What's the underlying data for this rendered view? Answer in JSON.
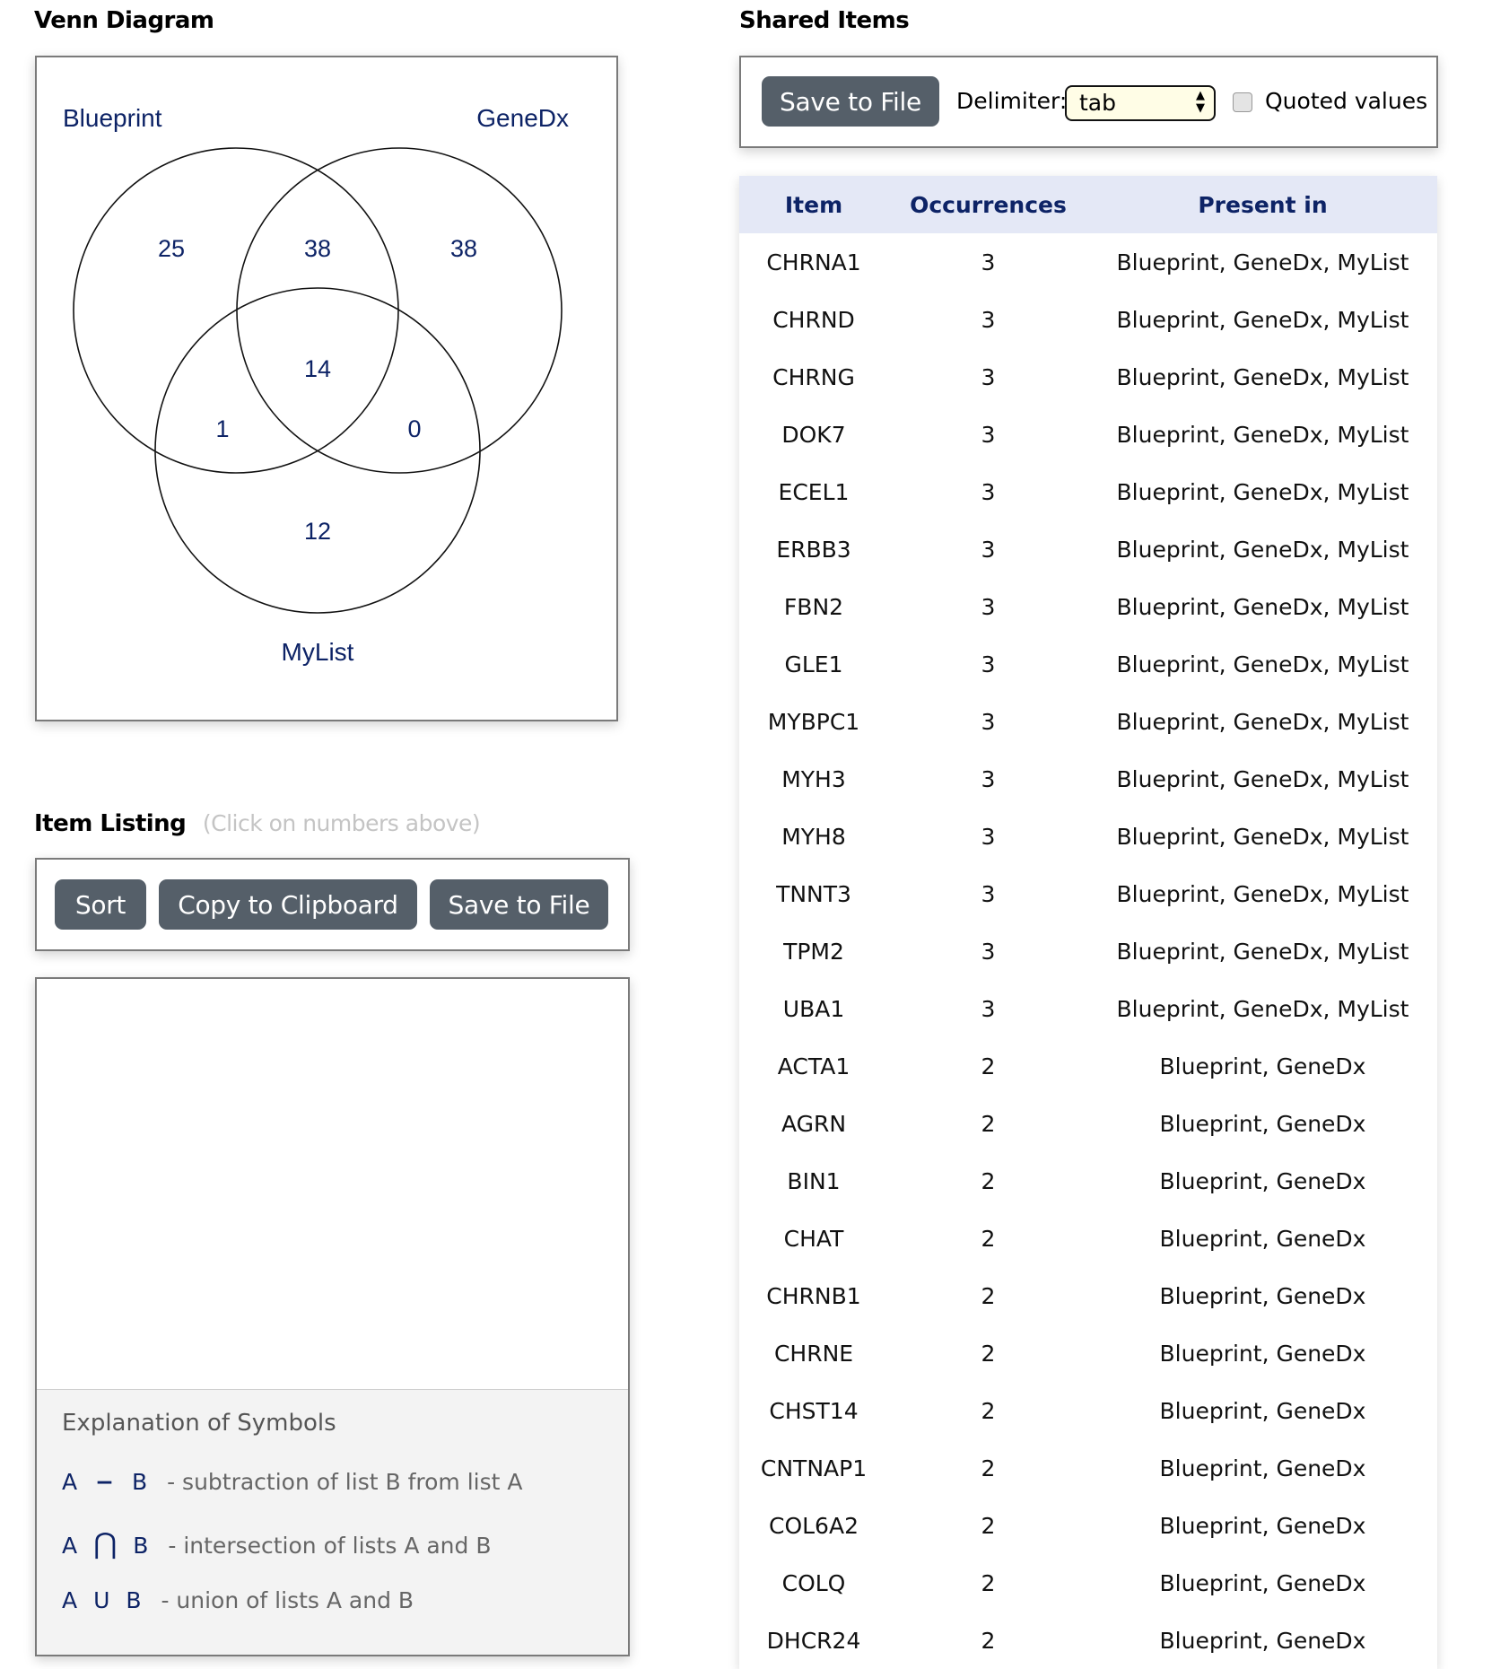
{
  "venn": {
    "title": "Venn Diagram",
    "sets": [
      "Blueprint",
      "GeneDx",
      "MyList"
    ],
    "regions": {
      "blueprint_only": "25",
      "blueprint_genedx": "38",
      "genedx_only": "38",
      "all_three": "14",
      "blueprint_mylist": "1",
      "genedx_mylist": "0",
      "mylist_only": "12"
    }
  },
  "listing": {
    "title": "Item Listing",
    "hint": "(Click on numbers above)",
    "buttons": {
      "sort": "Sort",
      "copy": "Copy to Clipboard",
      "save": "Save to File"
    },
    "explanation": {
      "title": "Explanation of Symbols",
      "rows": [
        {
          "a": "A",
          "op": "−",
          "b": "B",
          "text": "- subtraction of list B from list A"
        },
        {
          "a": "A",
          "op": "⋂",
          "b": "B",
          "text": "- intersection of lists A and B"
        },
        {
          "a": "A",
          "op": "U",
          "b": "B",
          "text": "- union of lists A and B"
        }
      ]
    }
  },
  "shared": {
    "title": "Shared Items",
    "save_label": "Save to File",
    "delimiter_label": "Delimiter:",
    "delimiter_value": "tab",
    "quoted_label": "Quoted values",
    "quoted_checked": false,
    "columns": [
      "Item",
      "Occurrences",
      "Present in"
    ],
    "rows": [
      [
        "CHRNA1",
        "3",
        "Blueprint, GeneDx, MyList"
      ],
      [
        "CHRND",
        "3",
        "Blueprint, GeneDx, MyList"
      ],
      [
        "CHRNG",
        "3",
        "Blueprint, GeneDx, MyList"
      ],
      [
        "DOK7",
        "3",
        "Blueprint, GeneDx, MyList"
      ],
      [
        "ECEL1",
        "3",
        "Blueprint, GeneDx, MyList"
      ],
      [
        "ERBB3",
        "3",
        "Blueprint, GeneDx, MyList"
      ],
      [
        "FBN2",
        "3",
        "Blueprint, GeneDx, MyList"
      ],
      [
        "GLE1",
        "3",
        "Blueprint, GeneDx, MyList"
      ],
      [
        "MYBPC1",
        "3",
        "Blueprint, GeneDx, MyList"
      ],
      [
        "MYH3",
        "3",
        "Blueprint, GeneDx, MyList"
      ],
      [
        "MYH8",
        "3",
        "Blueprint, GeneDx, MyList"
      ],
      [
        "TNNT3",
        "3",
        "Blueprint, GeneDx, MyList"
      ],
      [
        "TPM2",
        "3",
        "Blueprint, GeneDx, MyList"
      ],
      [
        "UBA1",
        "3",
        "Blueprint, GeneDx, MyList"
      ],
      [
        "ACTA1",
        "2",
        "Blueprint, GeneDx"
      ],
      [
        "AGRN",
        "2",
        "Blueprint, GeneDx"
      ],
      [
        "BIN1",
        "2",
        "Blueprint, GeneDx"
      ],
      [
        "CHAT",
        "2",
        "Blueprint, GeneDx"
      ],
      [
        "CHRNB1",
        "2",
        "Blueprint, GeneDx"
      ],
      [
        "CHRNE",
        "2",
        "Blueprint, GeneDx"
      ],
      [
        "CHST14",
        "2",
        "Blueprint, GeneDx"
      ],
      [
        "CNTNAP1",
        "2",
        "Blueprint, GeneDx"
      ],
      [
        "COL6A2",
        "2",
        "Blueprint, GeneDx"
      ],
      [
        "COLQ",
        "2",
        "Blueprint, GeneDx"
      ],
      [
        "DHCR24",
        "2",
        "Blueprint, GeneDx"
      ]
    ]
  }
}
